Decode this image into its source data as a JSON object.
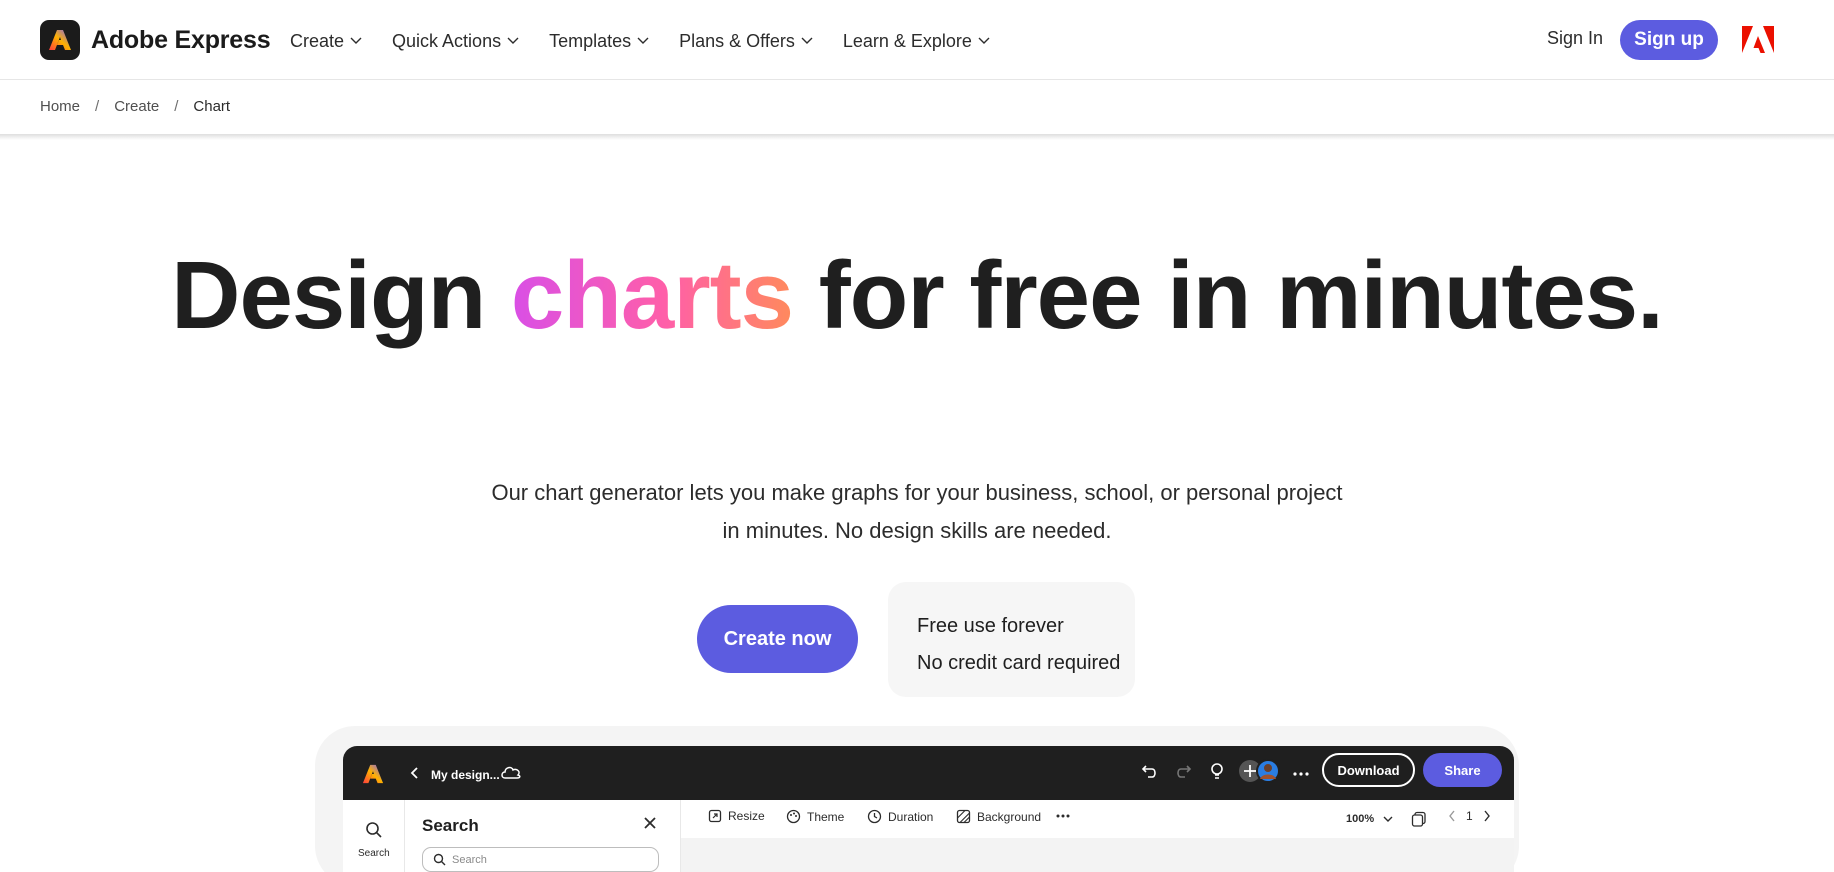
{
  "header": {
    "brand": "Adobe Express",
    "nav": [
      {
        "label": "Create"
      },
      {
        "label": "Quick Actions"
      },
      {
        "label": "Templates"
      },
      {
        "label": "Plans & Offers"
      },
      {
        "label": "Learn & Explore"
      }
    ],
    "sign_in": "Sign In",
    "sign_up": "Sign up",
    "adobe_logo_icon": "adobe-logo-icon"
  },
  "breadcrumb": {
    "items": [
      "Home",
      "Create",
      "Chart"
    ],
    "separator": "/"
  },
  "hero": {
    "title_before": "Design ",
    "title_highlight": "charts",
    "title_after": " for free in minutes.",
    "subtitle": "Our chart generator lets you make graphs for your business, school, or personal project in minutes. No design skills are needed.",
    "cta": "Create now",
    "perks": [
      "Free use forever",
      "No credit card required"
    ]
  },
  "mockup": {
    "doc_title": "My design...",
    "download": "Download",
    "share": "Share",
    "rail_label": "Search",
    "panel_title": "Search",
    "search_placeholder": "Search",
    "toolbar": [
      "Resize",
      "Theme",
      "Duration",
      "Background"
    ],
    "zoom": "100%",
    "page": "1"
  },
  "colors": {
    "accent": "#5c5ce0",
    "dark": "#1f1f1f",
    "gradient": [
      "#d94fe6",
      "#ff5fa8",
      "#ff8a5c"
    ],
    "adobe_red": "#eb1000"
  }
}
